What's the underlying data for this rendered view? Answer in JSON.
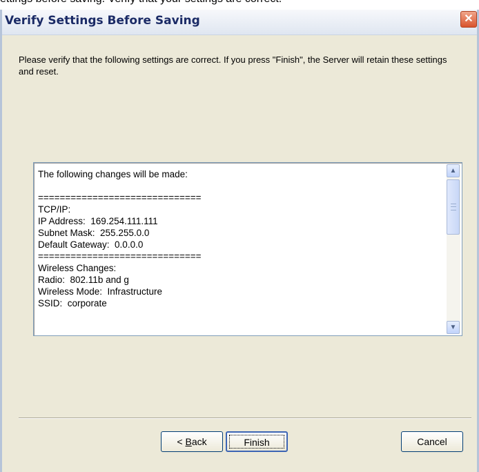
{
  "background_text": "ettings before saving. Verify that your settings are correct.",
  "dialog": {
    "title": "Verify Settings Before Saving",
    "close_glyph": "✕",
    "intro_text": "Please verify that the following settings are correct.  If you press \"Finish\", the Server will retain these settings and reset."
  },
  "changes": {
    "lines": [
      "The following changes will be made:",
      "",
      "==============================",
      "TCP/IP:",
      "IP Address:  169.254.111.111",
      "Subnet Mask:  255.255.0.0",
      "Default Gateway:  0.0.0.0",
      "==============================",
      "Wireless Changes:",
      "Radio:  802.11b and g",
      "Wireless Mode:  Infrastructure",
      "SSID:  corporate"
    ],
    "scroll_up_icon": "▲",
    "scroll_down_icon": "▼"
  },
  "buttons": {
    "back_prefix": "< ",
    "back_mnemonic": "B",
    "back_rest": "ack",
    "finish": "Finish",
    "cancel": "Cancel"
  }
}
